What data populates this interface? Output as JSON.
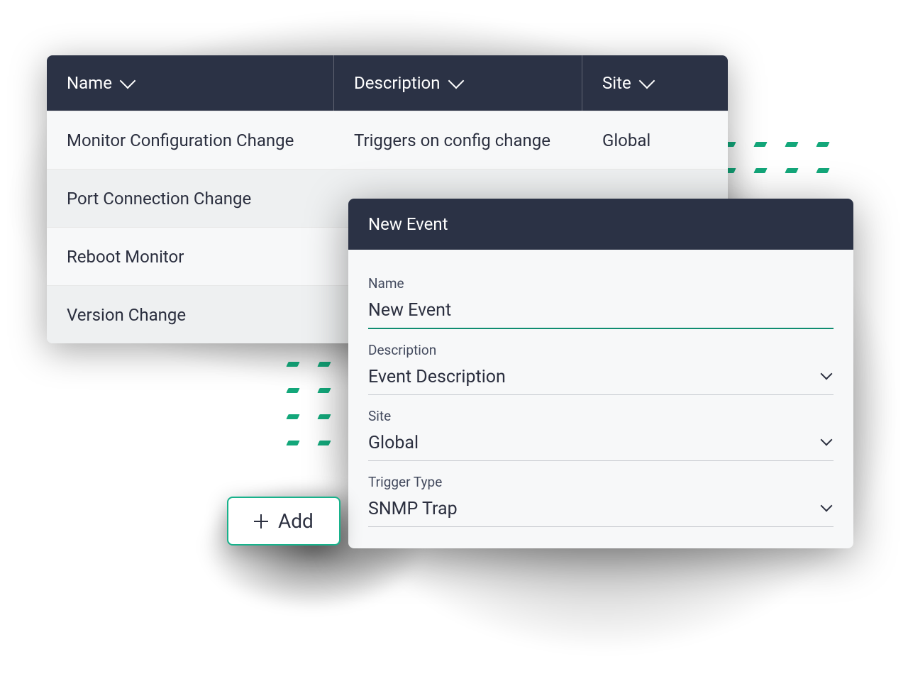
{
  "table": {
    "headers": {
      "name": "Name",
      "description": "Description",
      "site": "Site"
    },
    "rows": [
      {
        "name": "Monitor Configuration Change",
        "description": "Triggers on config change",
        "site": "Global"
      },
      {
        "name": "Port Connection Change",
        "description": "",
        "site": ""
      },
      {
        "name": "Reboot Monitor",
        "description": "",
        "site": ""
      },
      {
        "name": "Version Change",
        "description": "",
        "site": ""
      }
    ]
  },
  "form": {
    "title": "New Event",
    "fields": {
      "name": {
        "label": "Name",
        "value": "New Event"
      },
      "description": {
        "label": "Description",
        "value": "Event Description"
      },
      "site": {
        "label": "Site",
        "value": "Global"
      },
      "trigger": {
        "label": "Trigger Type",
        "value": "SNMP Trap"
      }
    }
  },
  "add_button": {
    "label": "Add"
  },
  "colors": {
    "accent": "#17b28b",
    "header_bg": "#2b3245"
  }
}
